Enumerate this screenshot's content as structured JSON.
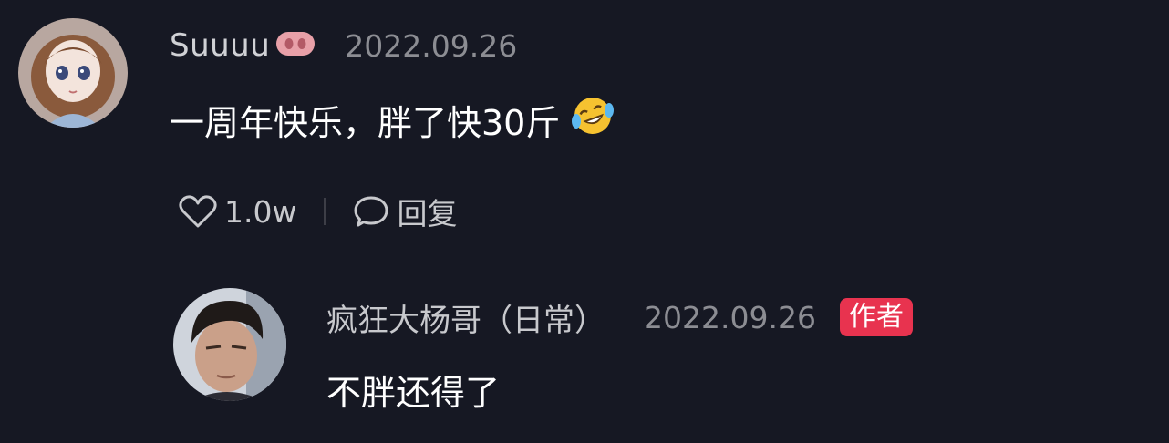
{
  "comment": {
    "username": "Suuuu",
    "user_badge_icon": "pig-nose-icon",
    "date": "2022.09.26",
    "text": "一周年快乐，胖了快30斤",
    "emoji_icon": "laughing-crying-emoji-icon",
    "like_count": "1.0w",
    "reply_label": "回复"
  },
  "reply": {
    "username": "疯狂大杨哥（日常）",
    "date": "2022.09.26",
    "badge": "作者",
    "text": "不胖还得了"
  },
  "colors": {
    "background": "#161823",
    "author_badge": "#e8334f",
    "date_gray": "#8c8d93"
  }
}
